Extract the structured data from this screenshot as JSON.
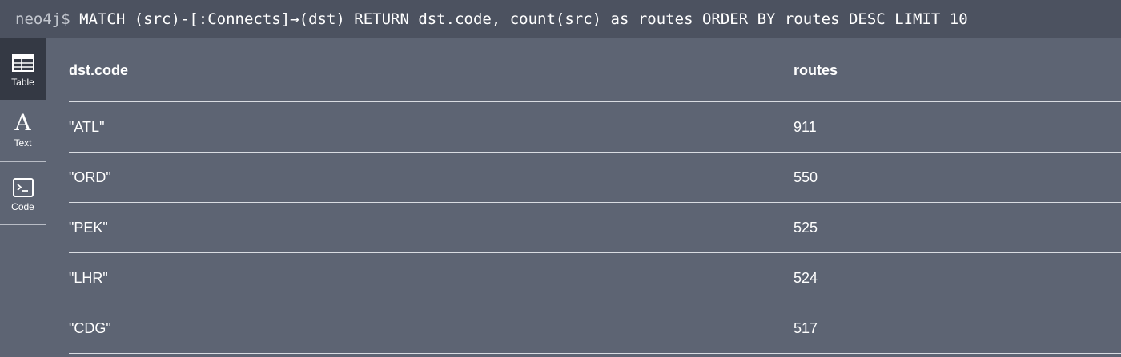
{
  "query_bar": {
    "prompt": "neo4j$",
    "query": "MATCH (src)-[:Connects]→(dst) RETURN dst.code, count(src) as routes ORDER BY routes DESC LIMIT 10"
  },
  "sidebar": {
    "items": [
      {
        "label": "Table",
        "icon": "table-icon",
        "active": true
      },
      {
        "label": "Text",
        "icon": "text-icon",
        "active": false
      },
      {
        "label": "Code",
        "icon": "code-icon",
        "active": false
      }
    ]
  },
  "table": {
    "headers": [
      "dst.code",
      "routes"
    ],
    "rows": [
      [
        "\"ATL\"",
        "911"
      ],
      [
        "\"ORD\"",
        "550"
      ],
      [
        "\"PEK\"",
        "525"
      ],
      [
        "\"LHR\"",
        "524"
      ],
      [
        "\"CDG\"",
        "517"
      ]
    ]
  },
  "colors": {
    "background": "#5d6473",
    "query_bar": "#4c5260",
    "active_tab": "#343944",
    "text": "#ffffff"
  }
}
